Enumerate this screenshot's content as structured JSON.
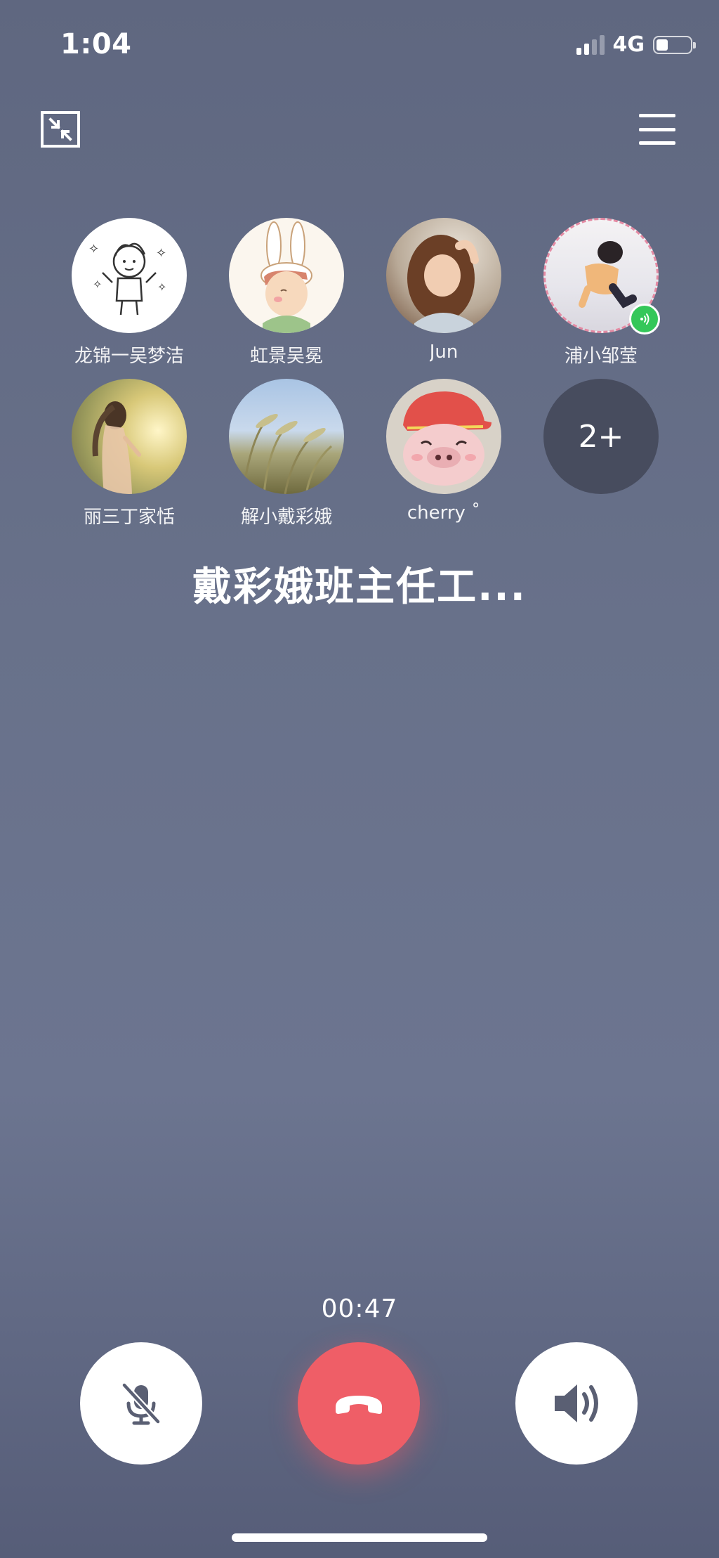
{
  "status_bar": {
    "time": "1:04",
    "network": "4G",
    "signal_bars_active": 2,
    "signal_bars_total": 4,
    "battery_level": 0.35
  },
  "top_bar": {
    "minimize_icon": "minimize-window-icon",
    "menu_icon": "menu-icon"
  },
  "participants": [
    {
      "name": "龙锦一吴梦洁",
      "avatar": "cartoon-boy-sketch"
    },
    {
      "name": "虹景吴冕",
      "avatar": "cartoon-bunny-hat"
    },
    {
      "name": "Jun",
      "avatar": "girl-photo"
    },
    {
      "name": "浦小邹莹",
      "avatar": "child-snow-photo",
      "speaking": true
    },
    {
      "name": "丽三丁家恬",
      "avatar": "girl-sunset-photo"
    },
    {
      "name": "解小戴彩娥",
      "avatar": "grass-field-photo"
    },
    {
      "name": "cherry ˚",
      "avatar": "cartoon-pig-cap"
    }
  ],
  "more_participants": "2+",
  "group_name": "戴彩娥班主任工...",
  "call_duration": "00:47",
  "controls": {
    "mute_icon": "mic-muted-icon",
    "hangup_icon": "phone-hangup-icon",
    "speaker_icon": "speaker-icon"
  },
  "colors": {
    "hangup": "#ef5e67",
    "speaking_badge": "#34c759",
    "more_circle": "#474c5e"
  }
}
